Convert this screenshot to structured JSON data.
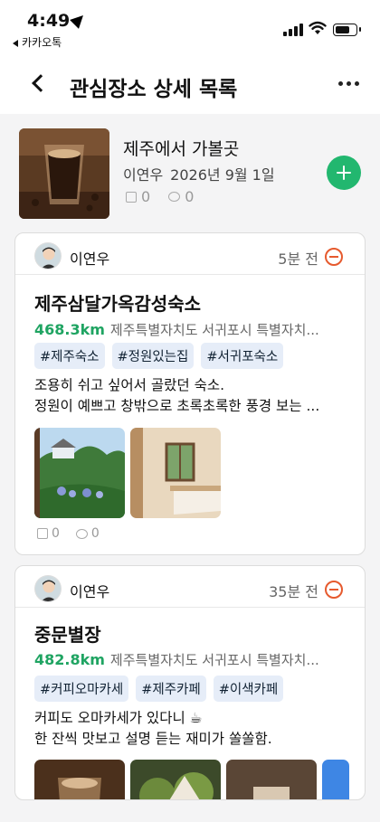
{
  "status_bar": {
    "time": "4:49",
    "back_app": "카카오톡"
  },
  "header": {
    "title": "관심장소 상세 목록"
  },
  "list": {
    "title": "제주에서 가볼곳",
    "author": "이연우",
    "date": "2026년 9월 1일",
    "likes": "0",
    "comments": "0"
  },
  "posts": [
    {
      "author": "이연우",
      "ago": "5분 전",
      "place": "제주삼달가옥감성숙소",
      "distance": "468.3km",
      "address": "제주특별자치도 서귀포시 특별자치...",
      "tags": [
        "#제주숙소",
        "#정원있는집",
        "#서귀포숙소"
      ],
      "desc_line1": "조용히 쉬고 싶어서 골랐던 숙소.",
      "desc_line2": "정원이 예쁘고 창밖으로 초록초록한 풍경 보는 ...",
      "likes": "0",
      "comments": "0"
    },
    {
      "author": "이연우",
      "ago": "35분 전",
      "place": "중문별장",
      "distance": "482.8km",
      "address": "제주특별자치도 서귀포시 특별자치...",
      "tags": [
        "#커피오마카세",
        "#제주카페",
        "#이색카페"
      ],
      "desc_line1": "커피도 오마카세가 있다니 ☕",
      "desc_line2": "한 잔씩 맛보고 설명 듣는 재미가 쏠쏠함."
    }
  ],
  "colors": {
    "accent": "#22b76f",
    "distance": "#1fa462",
    "remove": "#e65a2e",
    "tag_bg": "#e6edf8"
  }
}
